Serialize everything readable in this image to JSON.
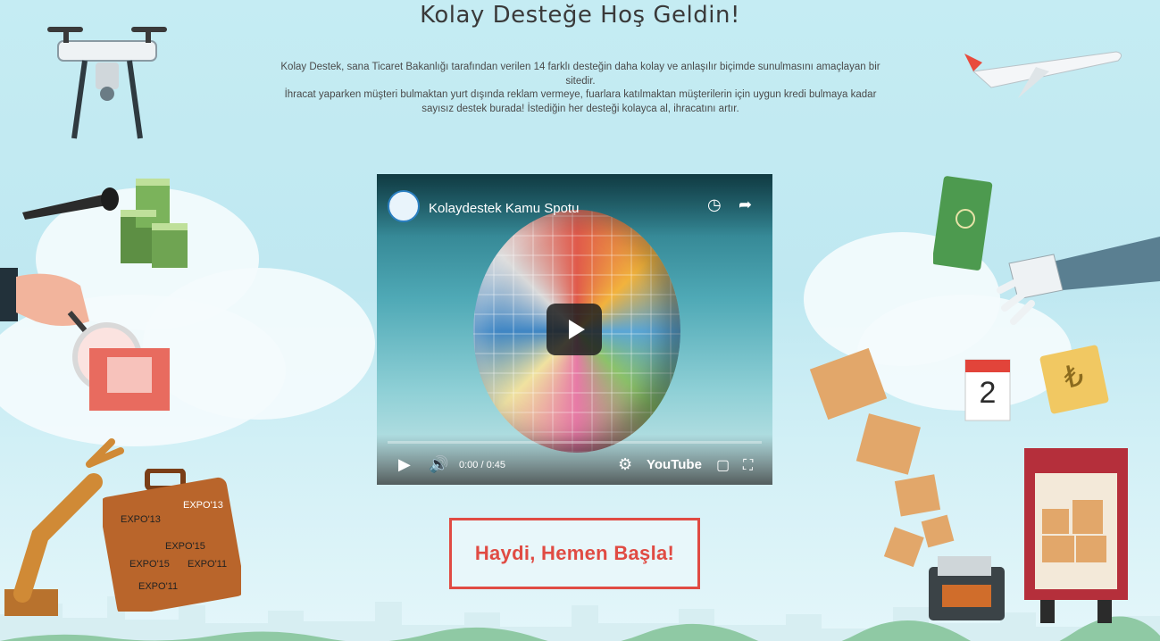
{
  "header": {
    "title": "Kolay Desteğe Hoş Geldin!"
  },
  "intro": {
    "line1": "Kolay Destek, sana Ticaret Bakanlığı tarafından verilen 14 farklı desteğin daha kolay ve anlaşılır biçimde sunulmasını amaçlayan bir sitedir.",
    "line2": "İhracat yaparken müşteri bulmaktan yurt dışında reklam vermeye, fuarlara katılmaktan müşterilerin için uygun kredi bulmaya kadar sayısız destek burada! İstediğin her desteği kolayca al, ihracatını artır."
  },
  "video": {
    "title": "Kolaydestek Kamu Spotu",
    "time": "0:00 / 0:45",
    "brand": "YouTube",
    "icons": [
      "clock-icon",
      "share-icon",
      "play-icon",
      "volume-icon",
      "settings-icon",
      "cast-icon",
      "fullscreen-icon"
    ]
  },
  "cta": {
    "label": "Haydi, Hemen Başla!"
  },
  "illustration_text": {
    "calendar_day": "2",
    "lira_symbol": "₺",
    "expo_tags": [
      "EXPO'13",
      "EXPO'13",
      "EXPO'15",
      "EXPO'11",
      "EXPO'15",
      "EXPO'11"
    ]
  },
  "colors": {
    "accent": "#e04b43",
    "sky": "#c5ecf3",
    "text": "#3a3a3a"
  }
}
